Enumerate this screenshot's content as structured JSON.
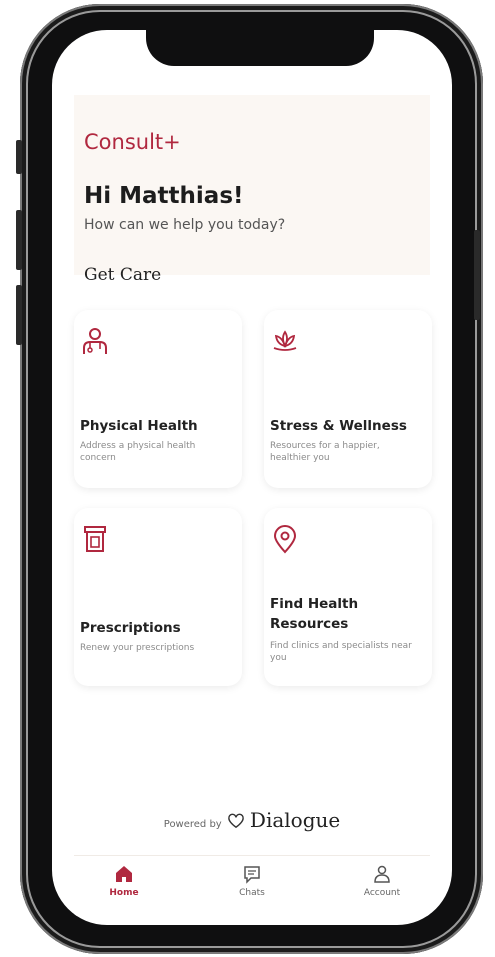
{
  "app": {
    "name": "Consult+"
  },
  "header": {
    "greeting": "Hi Matthias!",
    "subtitle": "How can we help you today?"
  },
  "section_title": "Get Care",
  "cards": [
    {
      "title": "Physical Health",
      "description": "Address a physical health concern",
      "icon": "doctor-icon"
    },
    {
      "title": "Stress & Wellness",
      "description": "Resources for a happier, healthier you",
      "icon": "lotus-icon"
    },
    {
      "title": "Prescriptions",
      "description": "Renew your prescriptions",
      "icon": "pill-bottle-icon"
    },
    {
      "title": "Find Health Resources",
      "description": "Find clinics and specialists near you",
      "icon": "location-pin-icon"
    }
  ],
  "footer": {
    "powered_by": "Powered by",
    "brand": "Dialogue"
  },
  "tabbar": [
    {
      "label": "Home",
      "icon": "home-icon",
      "active": true
    },
    {
      "label": "Chats",
      "icon": "chat-icon",
      "active": false
    },
    {
      "label": "Account",
      "icon": "user-icon",
      "active": false
    }
  ],
  "colors": {
    "accent": "#b0283f",
    "header_bg": "#fbf7f3"
  }
}
